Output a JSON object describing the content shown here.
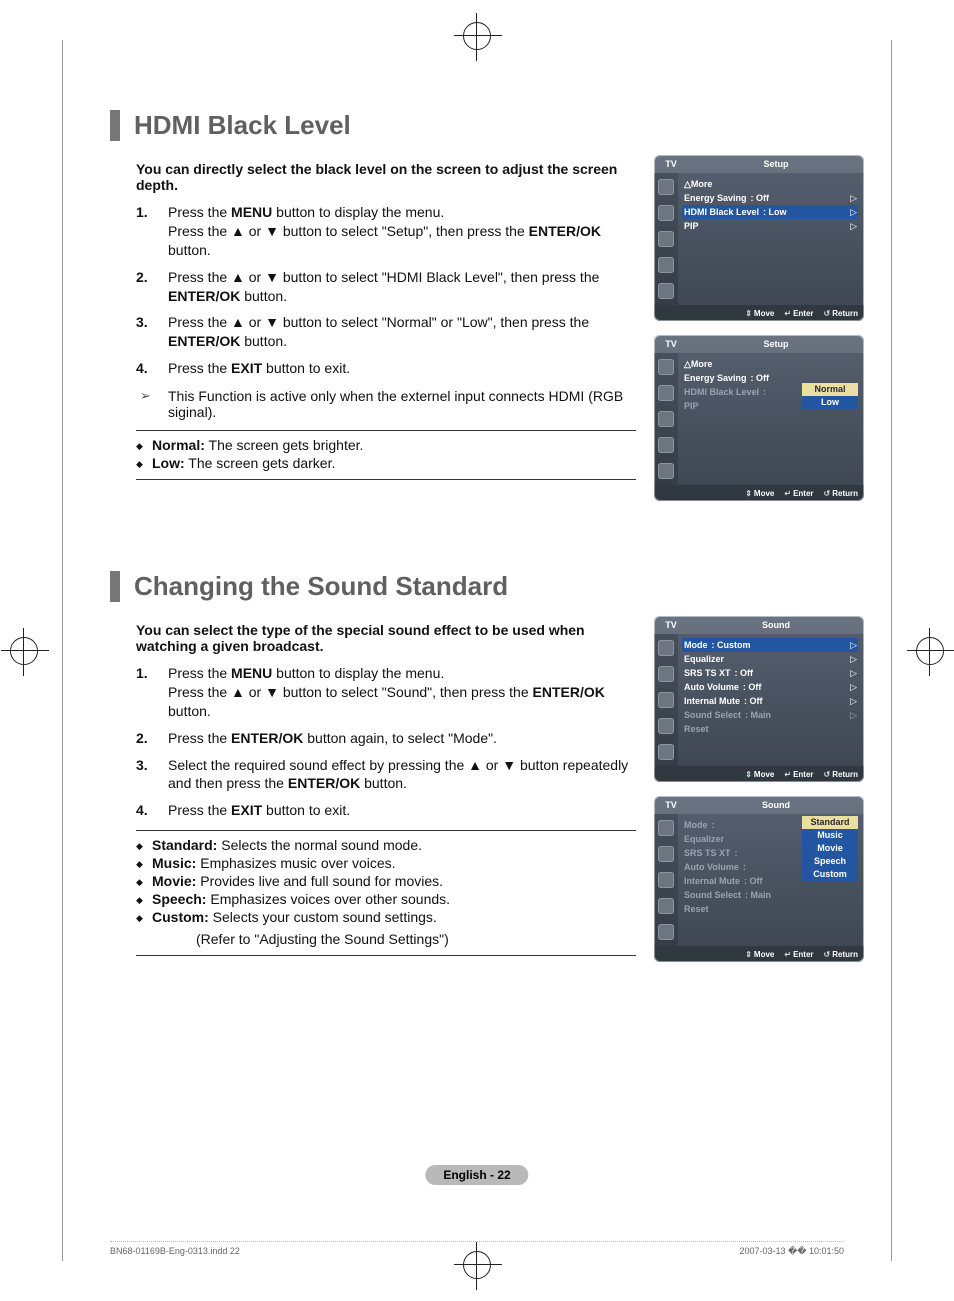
{
  "sections": {
    "hdmi": {
      "title": "HDMI Black Level",
      "intro": "You can directly select the black level on the screen to adjust the screen depth.",
      "steps": [
        {
          "a": "Press the ",
          "b1": "MENU",
          "c": " button to display the menu.\nPress the ▲ or ▼ button to select \"Setup\", then press the ",
          "b2": "ENTER/OK",
          "d": " button."
        },
        {
          "a": "Press the ▲ or ▼ button to select \"HDMI Black Level\", then press the ",
          "b1": "ENTER/OK",
          "c": " button."
        },
        {
          "a": "Press the ▲ or ▼ button to select \"Normal\" or \"Low\", then press the ",
          "b1": "ENTER/OK",
          "c": " button."
        },
        {
          "a": "Press the ",
          "b1": "EXIT",
          "c": " button to exit."
        }
      ],
      "note": "This Function is active only when the externel input connects HDMI (RGB siginal).",
      "defs": [
        {
          "term": "Normal:",
          "desc": " The screen gets brighter."
        },
        {
          "term": "Low:",
          "desc": " The screen gets darker."
        }
      ],
      "osd1": {
        "tv": "TV",
        "cap": "Setup",
        "more": "△More",
        "rows": [
          {
            "lbl": "Energy Saving",
            "val": ": Off",
            "arw": "▷"
          },
          {
            "lbl": "HDMI Black Level",
            "val": ": Low",
            "arw": "▷",
            "hl": true
          },
          {
            "lbl": "PIP",
            "val": "",
            "arw": "▷"
          }
        ],
        "ftr": {
          "mv": "Move",
          "en": "Enter",
          "rt": "Return"
        }
      },
      "osd2": {
        "tv": "TV",
        "cap": "Setup",
        "more": "△More",
        "rows": [
          {
            "lbl": "Energy Saving",
            "val": ": Off"
          },
          {
            "lbl": "HDMI Black Level",
            "val": ":",
            "dim": true
          },
          {
            "lbl": "PIP",
            "val": "",
            "dim": true
          }
        ],
        "opts": [
          {
            "t": "Normal",
            "sel": true
          },
          {
            "t": "Low"
          }
        ],
        "ftr": {
          "mv": "Move",
          "en": "Enter",
          "rt": "Return"
        }
      }
    },
    "sound": {
      "title": "Changing the Sound Standard",
      "intro": "You can select the type of the special sound effect to be used when watching a given broadcast.",
      "steps": [
        {
          "a": "Press the ",
          "b1": "MENU",
          "c": " button to display the menu.\nPress the ▲ or ▼ button to select \"Sound\", then press the ",
          "b2": "ENTER/OK",
          "d": " button."
        },
        {
          "a": "Press the ",
          "b1": "ENTER/OK",
          "c": " button again, to select \"Mode\"."
        },
        {
          "a": "Select the required sound effect by pressing the ▲ or ▼ button repeatedly and then press the ",
          "b1": "ENTER/OK",
          "c": " button."
        },
        {
          "a": "Press the ",
          "b1": "EXIT",
          "c": " button to exit."
        }
      ],
      "defs": [
        {
          "term": "Standard:",
          "desc": " Selects the normal sound mode."
        },
        {
          "term": "Music:",
          "desc": " Emphasizes music over voices."
        },
        {
          "term": "Movie:",
          "desc": " Provides live and full sound for movies."
        },
        {
          "term": "Speech:",
          "desc": " Emphasizes voices over other sounds."
        },
        {
          "term": "Custom:",
          "desc": " Selects your custom sound settings."
        }
      ],
      "subref": "(Refer to \"Adjusting the Sound Settings\")",
      "osd1": {
        "tv": "TV",
        "cap": "Sound",
        "rows": [
          {
            "lbl": "Mode",
            "val": ": Custom",
            "arw": "▷",
            "hl": true
          },
          {
            "lbl": "Equalizer",
            "val": "",
            "arw": "▷"
          },
          {
            "lbl": "SRS TS XT",
            "val": ": Off",
            "arw": "▷"
          },
          {
            "lbl": "Auto Volume",
            "val": ": Off",
            "arw": "▷"
          },
          {
            "lbl": "Internal Mute",
            "val": ": Off",
            "arw": "▷"
          },
          {
            "lbl": "Sound Select",
            "val": ": Main",
            "arw": "▷",
            "dim": true
          },
          {
            "lbl": "Reset",
            "val": "",
            "dim": true
          }
        ],
        "ftr": {
          "mv": "Move",
          "en": "Enter",
          "rt": "Return"
        }
      },
      "osd2": {
        "tv": "TV",
        "cap": "Sound",
        "rows": [
          {
            "lbl": "Mode",
            "val": ":",
            "dim": true
          },
          {
            "lbl": "Equalizer",
            "val": "",
            "dim": true
          },
          {
            "lbl": "SRS TS XT",
            "val": ":",
            "dim": true
          },
          {
            "lbl": "Auto Volume",
            "val": ":",
            "dim": true
          },
          {
            "lbl": "Internal Mute",
            "val": ": Off",
            "dim": true
          },
          {
            "lbl": "Sound Select",
            "val": ": Main",
            "dim": true
          },
          {
            "lbl": "Reset",
            "val": "",
            "dim": true
          }
        ],
        "opts": [
          {
            "t": "Standard",
            "sel": true
          },
          {
            "t": "Music"
          },
          {
            "t": "Movie"
          },
          {
            "t": "Speech"
          },
          {
            "t": "Custom"
          }
        ],
        "ftr": {
          "mv": "Move",
          "en": "Enter",
          "rt": "Return"
        }
      }
    }
  },
  "page_label": "English - 22",
  "footer": {
    "left": "BN68-01169B-Eng-0313.indd   22",
    "right": "2007-03-13   �� 10:01:50"
  }
}
